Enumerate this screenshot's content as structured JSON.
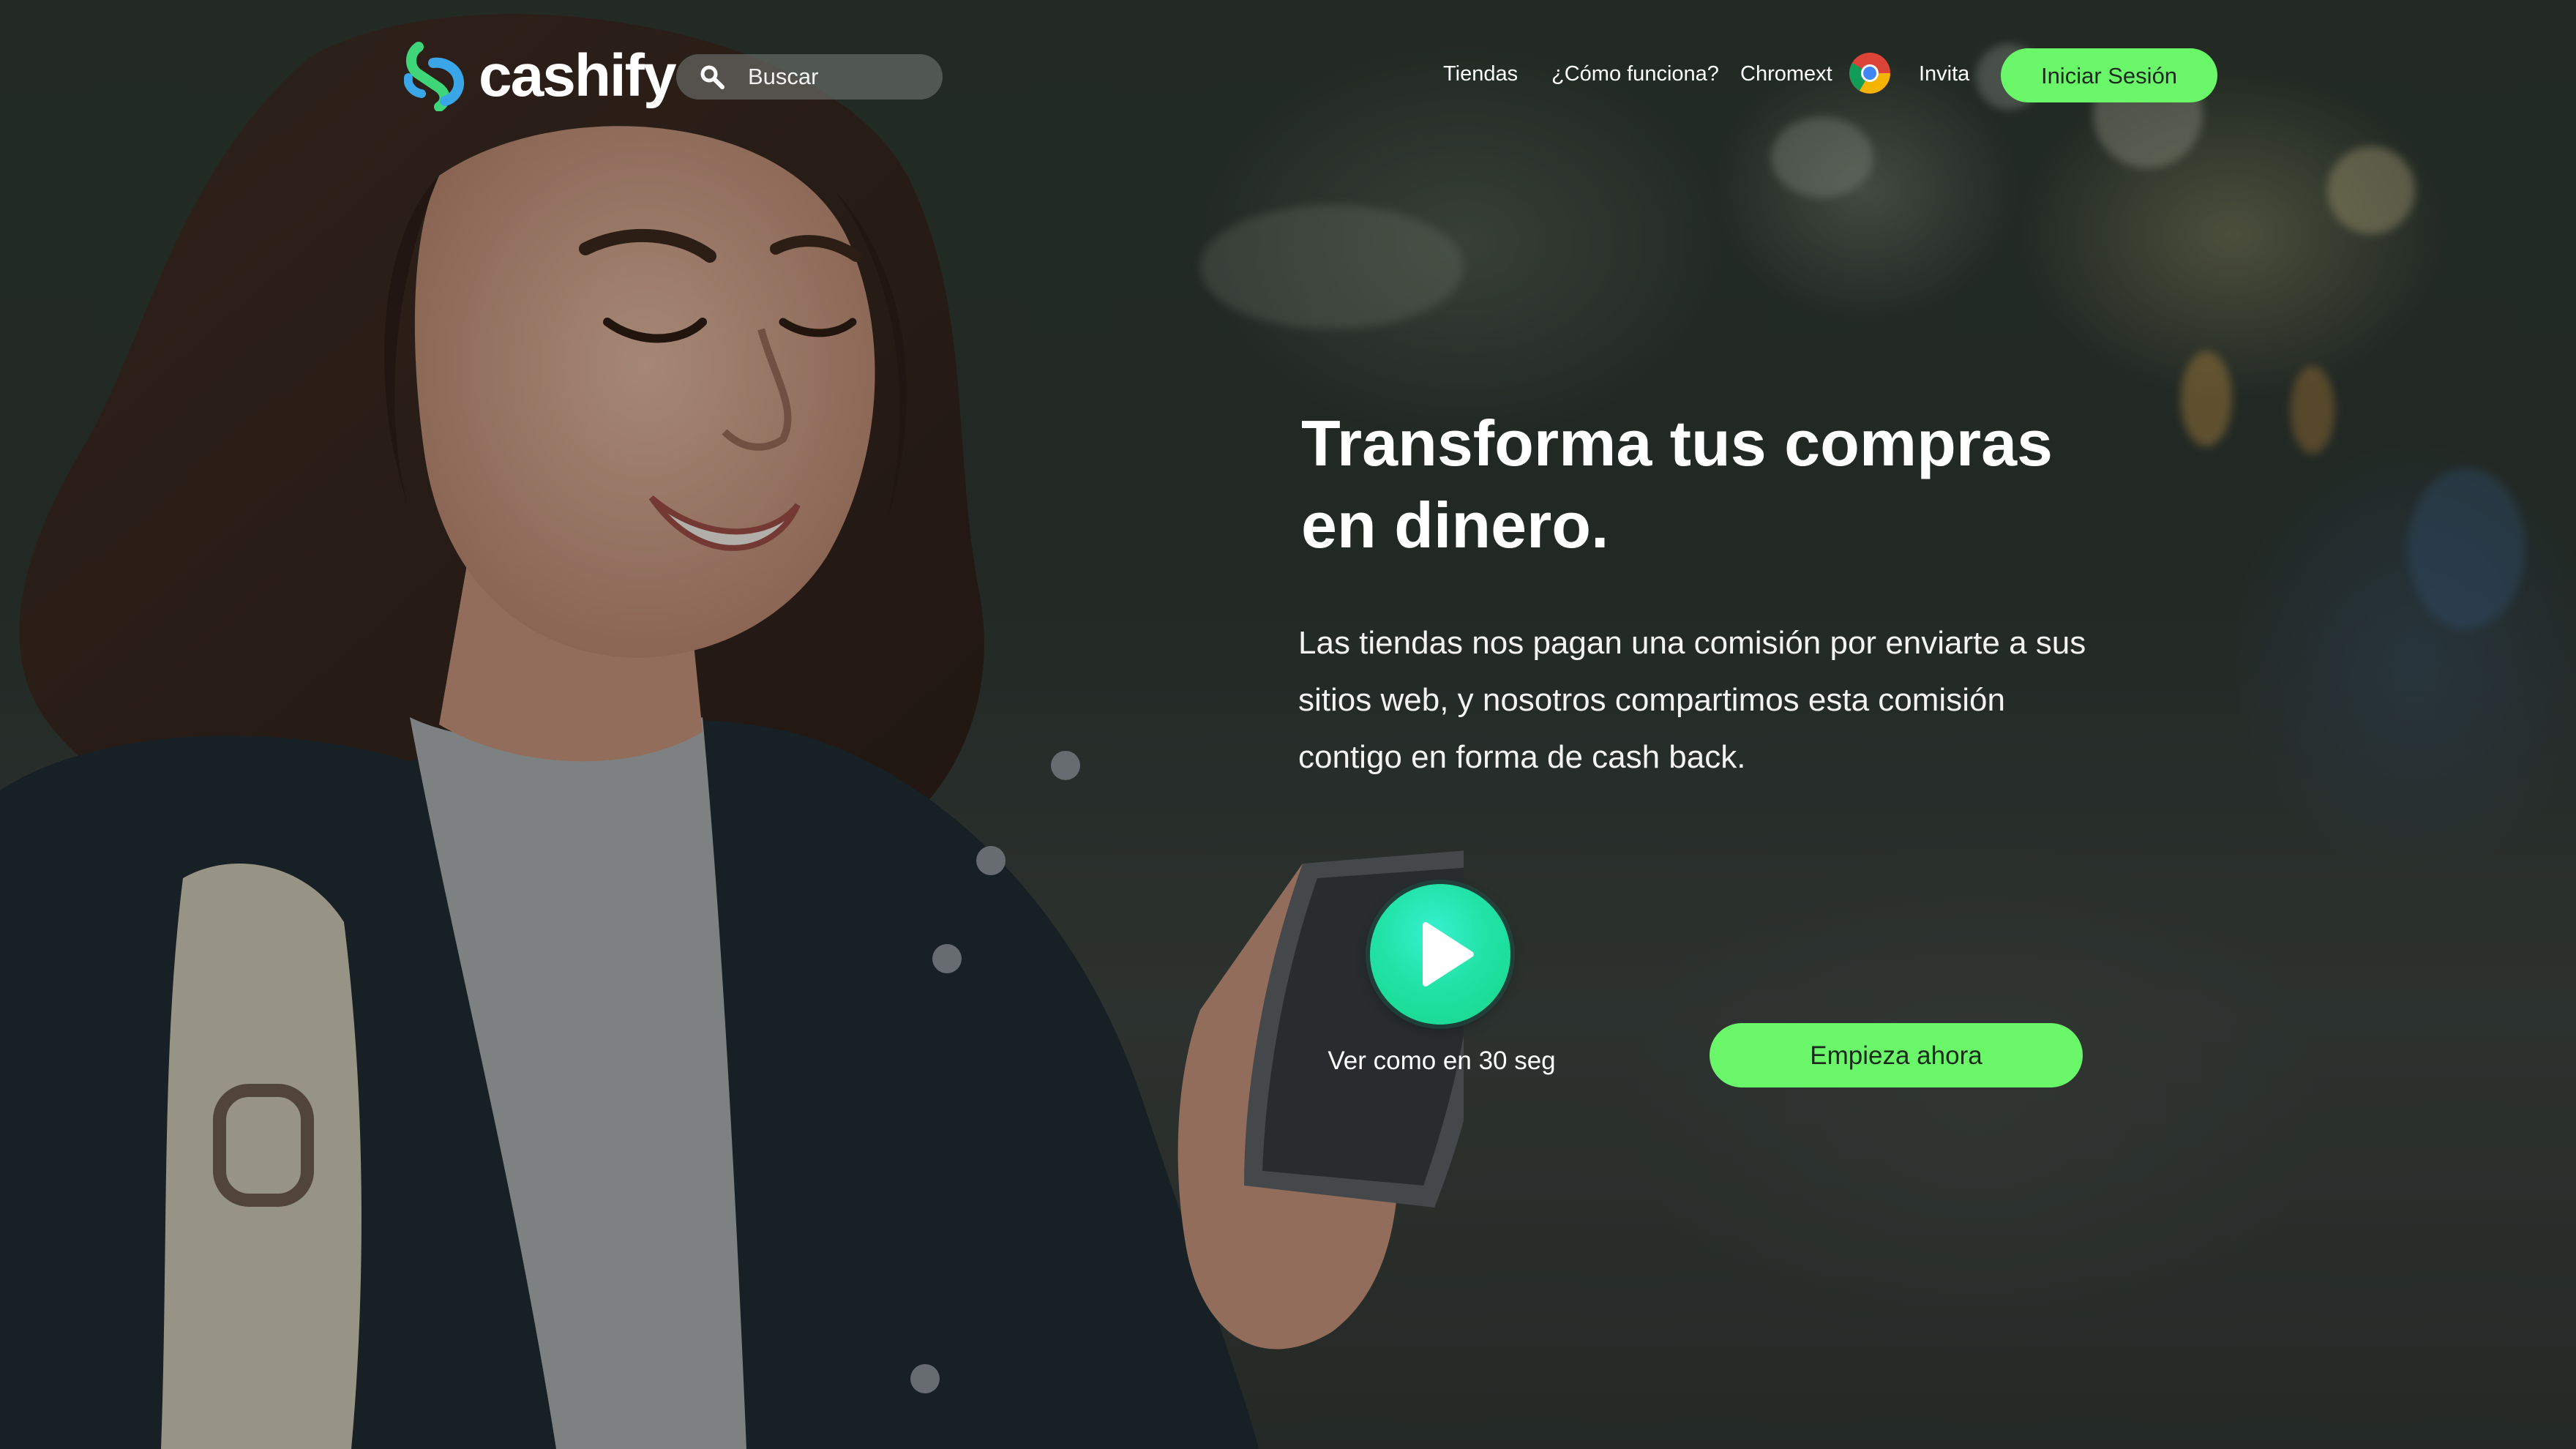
{
  "header": {
    "brand": "cashify",
    "search_placeholder": "Buscar",
    "nav": {
      "tiendas": "Tiendas",
      "como_funciona": "¿Cómo funciona?",
      "chromext": "Chromext",
      "invita": "Invita"
    },
    "login_label": "Iniciar Sesión"
  },
  "hero": {
    "title_lines": [
      "Transforma tus compras",
      "en dinero."
    ],
    "text_lines": [
      "Las tiendas nos pagan una comisión por enviarte a sus",
      "sitios web, y nosotros compartimos esta comisión",
      "contigo en forma de cash back."
    ],
    "video_caption": "Ver como en 30 seg",
    "cta_label": "Empieza ahora"
  },
  "icons": {
    "logo": "cashify-logo-icon",
    "search": "search-icon",
    "chrome": "chrome-icon",
    "play": "play-icon"
  },
  "colors": {
    "accent_green": "#6bf76a",
    "play_teal": "#21e3a6",
    "logo_green": "#3fd67a",
    "logo_blue": "#3aa6e8",
    "text": "#ffffff"
  }
}
